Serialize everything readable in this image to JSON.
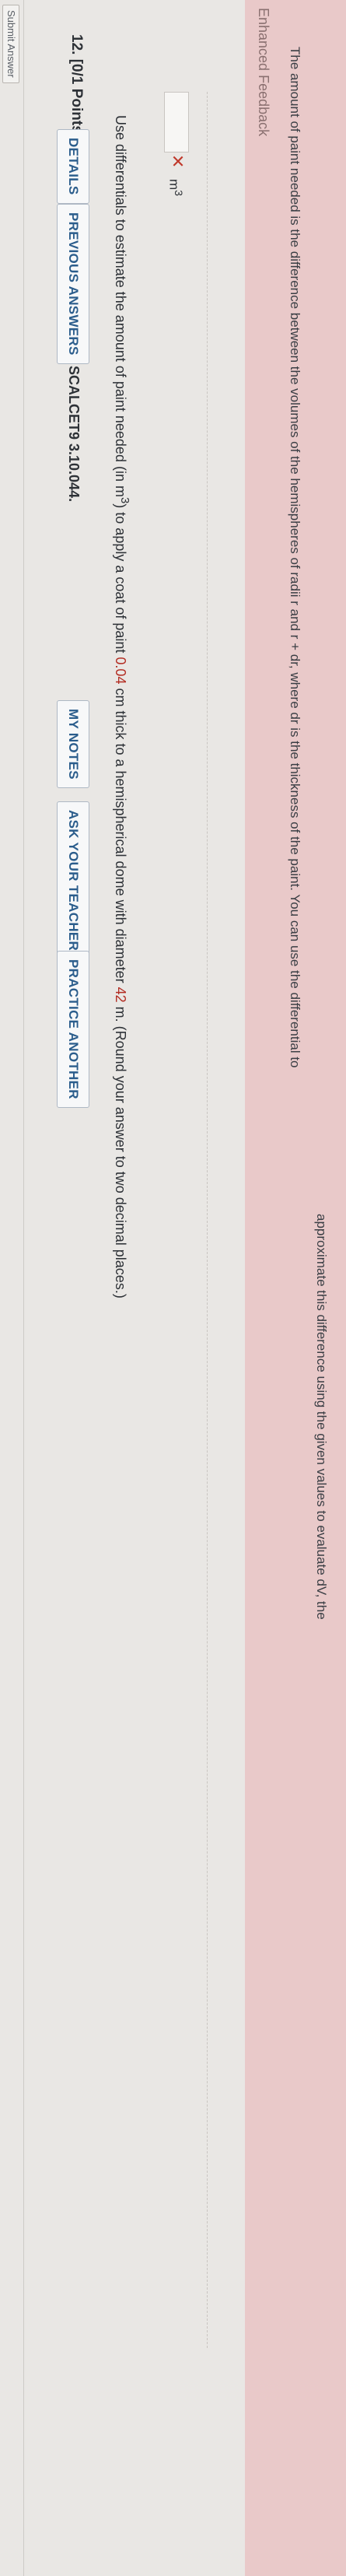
{
  "submit_button": "Submit Answer",
  "question": {
    "number": "12.",
    "points": "[0/1 Points]",
    "details_btn": "DETAILS",
    "prev_btn": "PREVIOUS ANSWERS",
    "code": "SCALCET9 3.10.044.",
    "notes_btn": "MY NOTES",
    "ask_btn": "ASK YOUR TEACHER",
    "practice_btn": "PRACTICE ANOTHER",
    "text_pre": "Use differentials to estimate the amount of paint needed (in m",
    "text_exp": "3",
    "text_mid1": ") to apply a coat of paint ",
    "thickness": "0.04",
    "text_mid2": " cm thick to a hemispherical dome with diameter ",
    "diameter": "42",
    "text_post": " m. (Round your answer to two decimal places.)"
  },
  "answer": {
    "value": "",
    "status_icon": "x-mark-icon",
    "unit": "m",
    "unit_exp": "3"
  },
  "feedback": {
    "title": "Enhanced Feedback",
    "line1": "The amount of paint needed is the difference between the volumes of the hemispheres of radii r and r + dr, where dr is the thickness of the paint. You can use the differential to",
    "line2": "approximate this difference using the given values to evaluate dV, the"
  },
  "colors": {
    "accent": "#2b5d8c",
    "highlight_values": "#b32d23",
    "error": "#c0392b",
    "feedback_bg": "#e9c9c9"
  }
}
